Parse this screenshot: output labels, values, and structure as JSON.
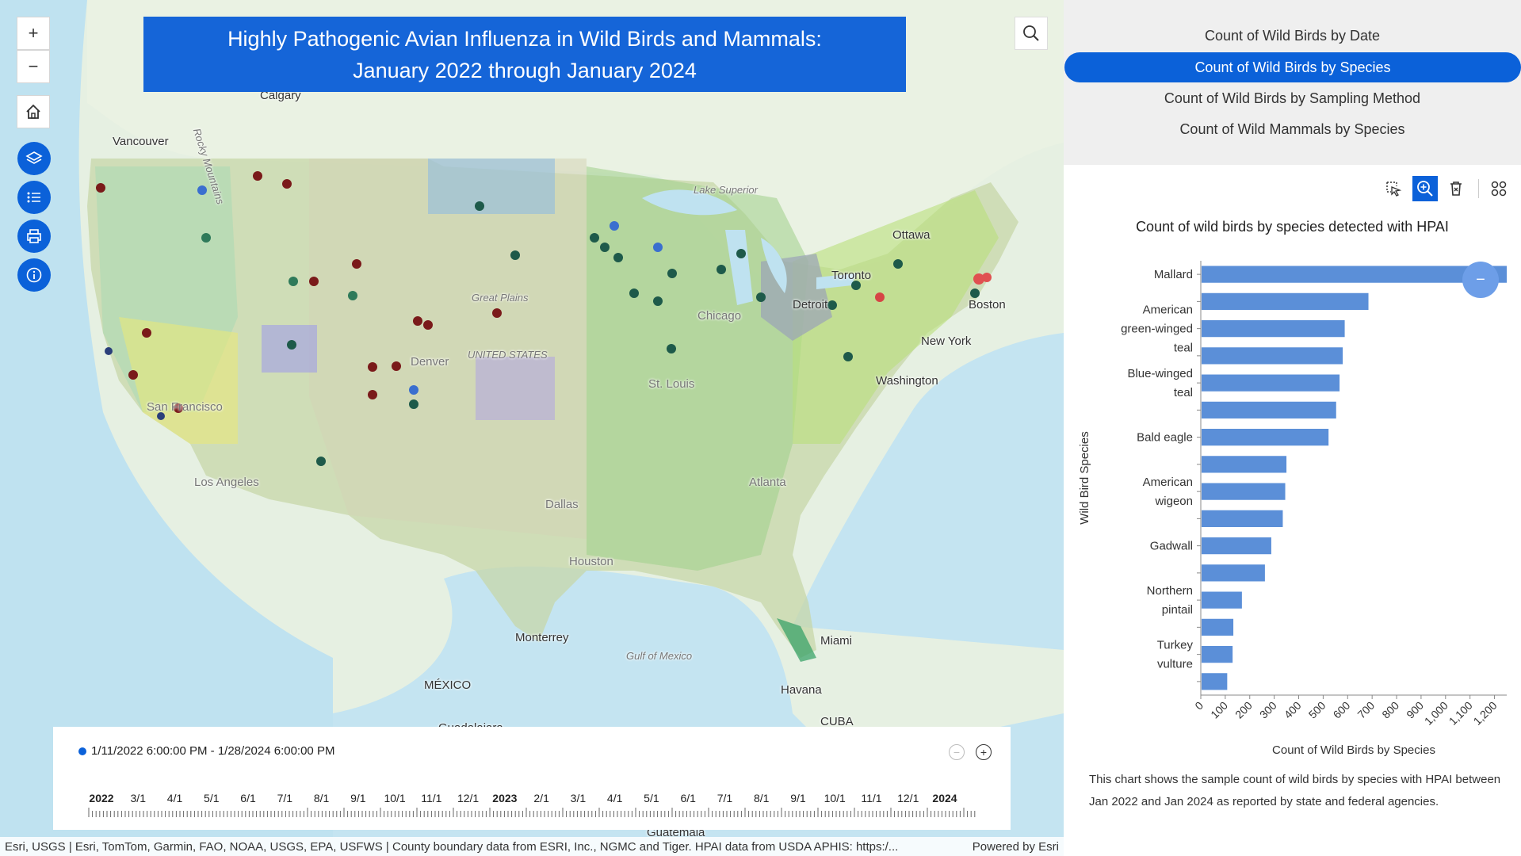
{
  "map": {
    "title_line1": "Highly Pathogenic Avian Influenza in Wild Birds and Mammals:",
    "title_line2": "January 2022 through January 2024",
    "controls": {
      "zoom_in": "+",
      "zoom_out": "−"
    },
    "place_labels": [
      {
        "text": "Calgary"
      },
      {
        "text": "Vancouver"
      },
      {
        "text": "Ottawa"
      },
      {
        "text": "Toronto"
      },
      {
        "text": "Detroit"
      },
      {
        "text": "Boston"
      },
      {
        "text": "New York"
      },
      {
        "text": "Washington"
      },
      {
        "text": "Chicago"
      },
      {
        "text": "St. Louis"
      },
      {
        "text": "Denver"
      },
      {
        "text": "Dallas"
      },
      {
        "text": "Houston"
      },
      {
        "text": "Atlanta"
      },
      {
        "text": "Miami"
      },
      {
        "text": "Havana"
      },
      {
        "text": "Monterrey"
      },
      {
        "text": "MÉXICO"
      },
      {
        "text": "CUBA"
      },
      {
        "text": "Los Angeles"
      },
      {
        "text": "San Francisco"
      },
      {
        "text": "Guadalajara"
      },
      {
        "text": "Guatemala"
      },
      {
        "text": "Lake Superior"
      },
      {
        "text": "Great Plains"
      },
      {
        "text": "UNITED STATES"
      },
      {
        "text": "Gulf of Mexico"
      },
      {
        "text": "Rocky Mountains"
      }
    ],
    "attribution_left": "Esri, USGS | Esri, TomTom, Garmin, FAO, NOAA, USGS, EPA, USFWS | County boundary data from ESRI, Inc., NGMC and Tiger. HPAI data from USDA APHIS: https:/...",
    "attribution_right": "Powered by Esri"
  },
  "timeslider": {
    "range_text": "1/11/2022 6:00:00 PM - 1/28/2024 6:00:00 PM",
    "labels": [
      "2022",
      "3/1",
      "4/1",
      "5/1",
      "6/1",
      "7/1",
      "8/1",
      "9/1",
      "10/1",
      "11/1",
      "12/1",
      "2023",
      "2/1",
      "3/1",
      "4/1",
      "5/1",
      "6/1",
      "7/1",
      "8/1",
      "9/1",
      "10/1",
      "11/1",
      "12/1",
      "2024"
    ],
    "zoom_out_label": "−",
    "zoom_in_label": "+"
  },
  "panel": {
    "tabs": [
      {
        "label": "Count of Wild Birds by Date",
        "active": false
      },
      {
        "label": "Count of Wild Birds by Species",
        "active": true
      },
      {
        "label": "Count of Wild Birds by Sampling Method",
        "active": false
      },
      {
        "label": "Count of Wild Mammals by Species",
        "active": false
      }
    ],
    "description": "This chart shows the sample count of wild birds by species with HPAI between Jan 2022 and Jan 2024 as reported by state and federal agencies.",
    "collapse_label": "−"
  },
  "chart_data": {
    "type": "bar",
    "orientation": "horizontal",
    "title": "Count of wild birds by species detected with HPAI",
    "xlabel": "Count of Wild Birds by Species",
    "ylabel": "Wild Bird Species",
    "xlim": [
      0,
      1250
    ],
    "xticks": [
      "0",
      "100",
      "200",
      "300",
      "400",
      "500",
      "600",
      "700",
      "800",
      "900",
      "1,000",
      "1,100",
      "1,200"
    ],
    "categories": [
      "Mallard",
      "",
      "American green-winged teal",
      "",
      "Blue-winged teal",
      "",
      "Bald eagle",
      "",
      "American wigeon",
      "",
      "Gadwall",
      "",
      "Northern pintail",
      "",
      "Turkey vulture",
      ""
    ],
    "values": [
      1250,
      685,
      588,
      580,
      567,
      553,
      522,
      350,
      345,
      335,
      288,
      262,
      168,
      133,
      130,
      108
    ],
    "color": "#5b8fd8"
  },
  "colors": {
    "accent": "#0b61d9",
    "title_bg": "#1565d8",
    "bar": "#5b8fd8"
  }
}
